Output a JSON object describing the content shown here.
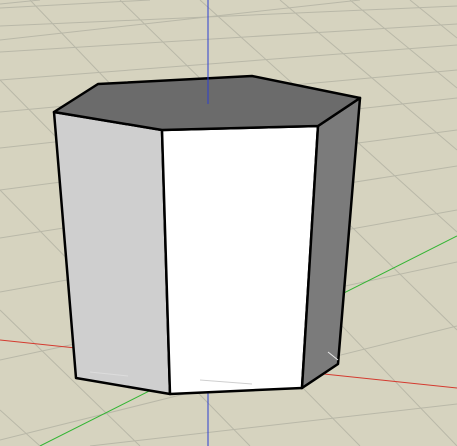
{
  "viewport": {
    "background_color": "#d6d3bf",
    "grid_color": "#b9b8a8",
    "axes": {
      "x_color": "#d43a2f",
      "y_color": "#33b533",
      "z_color": "#2c3fcf"
    },
    "model": {
      "shape": "hexagonal-prism",
      "top_face_color": "#6b6b6b",
      "front_face_color": "#ffffff",
      "left_face_color": "#cfcfcf",
      "right_face_color": "#7b7b7b",
      "edge_color": "#000000"
    }
  }
}
